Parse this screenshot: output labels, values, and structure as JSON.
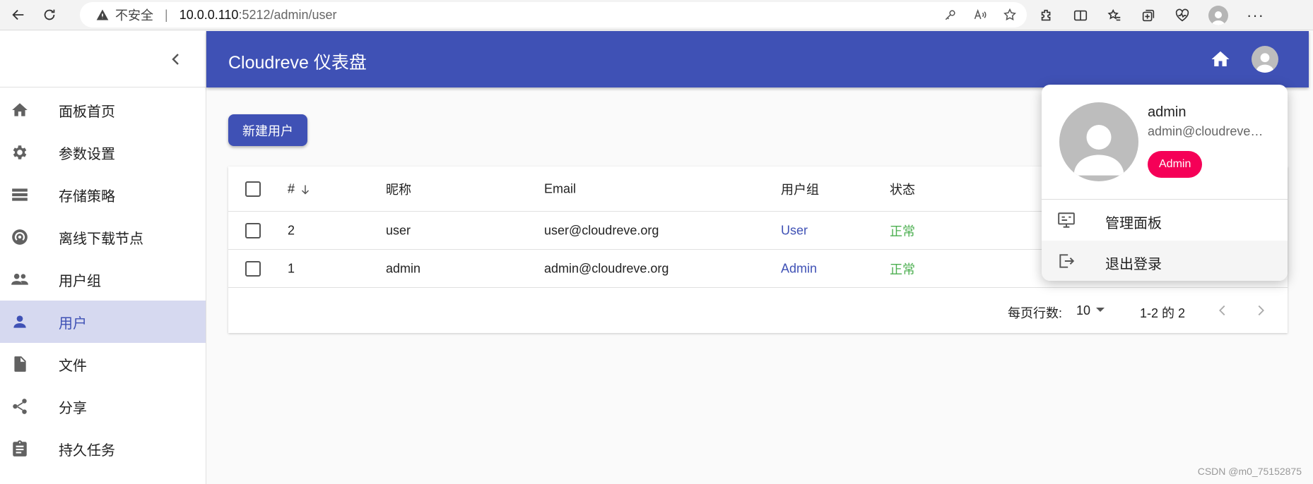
{
  "browser": {
    "insecure_label": "不安全",
    "url_host": "10.0.0.110",
    "url_rest": ":5212/admin/user"
  },
  "app": {
    "title": "Cloudreve 仪表盘"
  },
  "sidebar": {
    "items": [
      {
        "label": "面板首页",
        "icon": "home-icon"
      },
      {
        "label": "参数设置",
        "icon": "gear-icon"
      },
      {
        "label": "存储策略",
        "icon": "storage-icon"
      },
      {
        "label": "离线下载节点",
        "icon": "wifi-tethering-icon"
      },
      {
        "label": "用户组",
        "icon": "people-icon"
      },
      {
        "label": "用户",
        "icon": "person-icon",
        "active": true
      },
      {
        "label": "文件",
        "icon": "file-icon"
      },
      {
        "label": "分享",
        "icon": "share-icon"
      },
      {
        "label": "持久任务",
        "icon": "assignment-icon"
      }
    ]
  },
  "main": {
    "new_user_label": "新建用户",
    "table": {
      "headers": {
        "id": "#",
        "nickname": "昵称",
        "email": "Email",
        "group": "用户组",
        "status": "状态"
      },
      "rows": [
        {
          "id": "2",
          "nickname": "user",
          "email": "user@cloudreve.org",
          "group": "User",
          "status": "正常"
        },
        {
          "id": "1",
          "nickname": "admin",
          "email": "admin@cloudreve.org",
          "group": "Admin",
          "status": "正常"
        }
      ]
    },
    "pager": {
      "rows_per_page_label": "每页行数:",
      "rows_per_page_value": "10",
      "range": "1-2 的 2"
    }
  },
  "dropdown": {
    "name": "admin",
    "email": "admin@cloudreve.org",
    "badge": "Admin",
    "items": [
      {
        "label": "管理面板",
        "icon": "monitor-icon"
      },
      {
        "label": "退出登录",
        "icon": "logout-icon"
      }
    ]
  },
  "watermark": "CSDN @m0_75152875",
  "colors": {
    "primary": "#3f51b5",
    "accent": "#f50057",
    "status_ok": "#4caf50",
    "sidebar_active_bg": "#d6d9f0"
  }
}
